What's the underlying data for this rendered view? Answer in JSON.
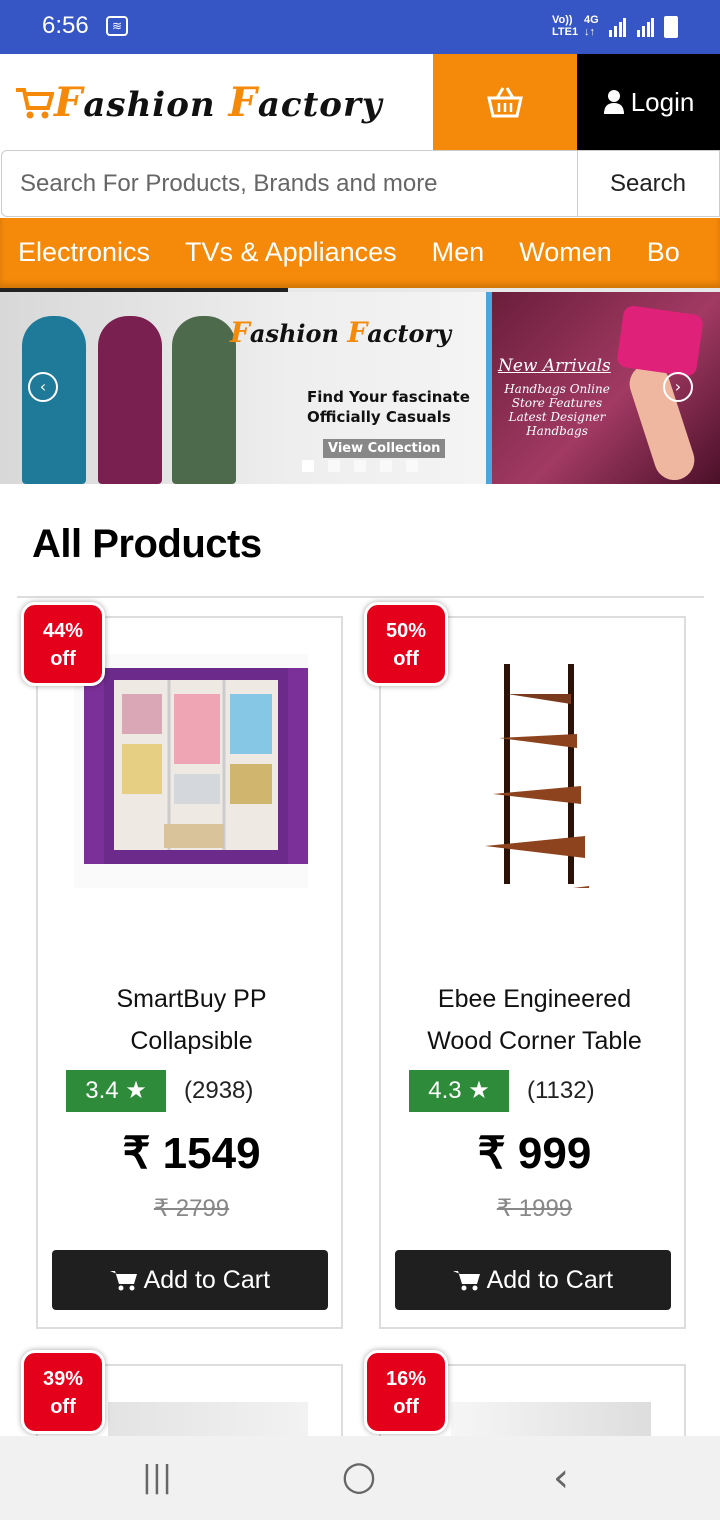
{
  "status_bar": {
    "time": "6:56",
    "network_top": "Vo))",
    "network_bottom": "LTE1",
    "network_type_top": "4G",
    "network_type_bottom": "↓↑"
  },
  "header": {
    "logo_text_first_cap": "F",
    "logo_text_first_rest": "ashion ",
    "logo_text_second_cap": "F",
    "logo_text_second_rest": "actory",
    "login_label": "Login",
    "accent_color": "#f5890a"
  },
  "search": {
    "placeholder": "Search For Products, Brands and more",
    "button_label": "Search"
  },
  "categories": [
    "Electronics",
    "TVs & Appliances",
    "Men",
    "Women",
    "Bo"
  ],
  "banner": {
    "slide1_brand_first_cap": "F",
    "slide1_brand_first_rest": "ashion ",
    "slide1_brand_second_cap": "F",
    "slide1_brand_second_rest": "actory",
    "slide1_tagline1": "Find Your fascinate",
    "slide1_tagline2": "Officially Casuals",
    "slide1_cta": "View Collection",
    "slide2_title": "New Arrivals",
    "slide2_lines": [
      "Handbags Online",
      "Store Features",
      "Latest Designer",
      "Handbags"
    ],
    "prev_icon": "‹",
    "next_icon": "›"
  },
  "section": {
    "title": "All Products"
  },
  "products": [
    {
      "discount_pct": "44%",
      "discount_word": "off",
      "name_line1": "SmartBuy PP",
      "name_line2": "Collapsible",
      "rating": "3.4",
      "reviews": "(2938)",
      "price": "₹ 1549",
      "mrp": "₹ 2799",
      "cta": "Add to Cart"
    },
    {
      "discount_pct": "50%",
      "discount_word": "off",
      "name_line1": "Ebee Engineered",
      "name_line2": "Wood Corner Table",
      "rating": "4.3",
      "reviews": "(1132)",
      "price": "₹ 999",
      "mrp": "₹ 1999",
      "cta": "Add to Cart"
    },
    {
      "discount_pct": "39%",
      "discount_word": "off"
    },
    {
      "discount_pct": "16%",
      "discount_word": "off"
    }
  ],
  "icons": {
    "star": "★",
    "cart": "cart-icon",
    "basket": "basket-icon",
    "user": "user-icon"
  },
  "system_nav": {
    "recents": "|||",
    "home": "○",
    "back": "‹"
  }
}
